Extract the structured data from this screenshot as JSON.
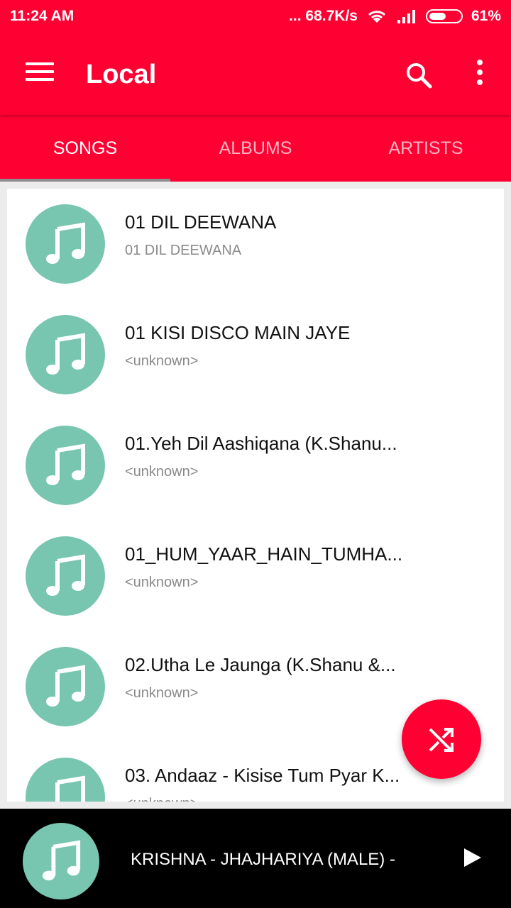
{
  "status": {
    "time": "11:24 AM",
    "speed": "68.7K/s",
    "battery": "61%",
    "battery_level": 0.61
  },
  "appbar": {
    "title": "Local",
    "menu_icon": "hamburger-menu-icon",
    "search_icon": "search-icon",
    "more_icon": "more-vert-icon"
  },
  "tabs": [
    {
      "label": "SONGS",
      "active": true
    },
    {
      "label": "ALBUMS",
      "active": false
    },
    {
      "label": "ARTISTS",
      "active": false
    }
  ],
  "songs": [
    {
      "title": "01 DIL DEEWANA",
      "subtitle": "01 DIL DEEWANA"
    },
    {
      "title": "01 KISI DISCO MAIN JAYE",
      "subtitle": "<unknown>"
    },
    {
      "title": "01.Yeh Dil Aashiqana (K.Shanu...",
      "subtitle": "<unknown>"
    },
    {
      "title": "01_HUM_YAAR_HAIN_TUMHA...",
      "subtitle": "<unknown>"
    },
    {
      "title": "02.Utha Le Jaunga (K.Shanu &...",
      "subtitle": "<unknown>"
    },
    {
      "title": "03. Andaaz - Kisise Tum Pyar K...",
      "subtitle": "<unknown>"
    }
  ],
  "fab": {
    "icon": "shuffle-icon"
  },
  "player": {
    "track": "KRISHNA - JHAJHARIYA (MALE) -",
    "play_icon": "play-icon"
  },
  "colors": {
    "accent": "#ff0033",
    "art": "#78c5b0"
  }
}
